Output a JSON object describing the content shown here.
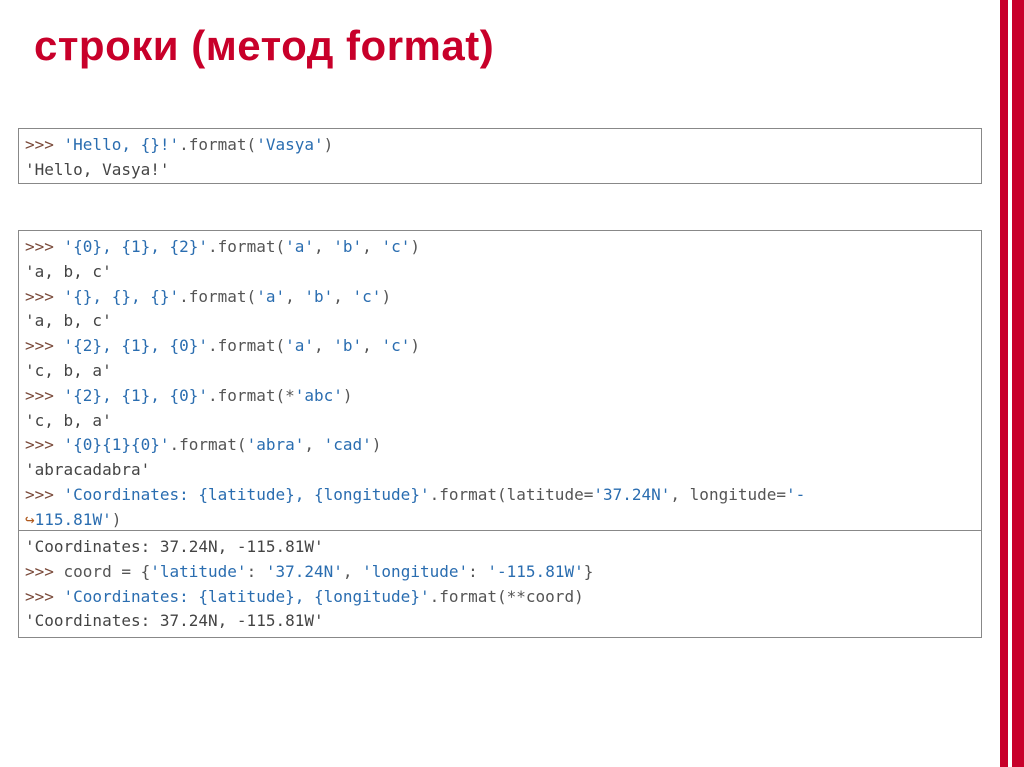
{
  "title": "строки (метод format)",
  "box1": {
    "l1_prompt": ">>> ",
    "l1_str": "'Hello, {}!'",
    "l1_call": ".format(",
    "l1_arg": "'Vasya'",
    "l1_close": ")",
    "l2": "'Hello, Vasya!'"
  },
  "box2": {
    "p": ">>> ",
    "l1_str": "'{0}, {1}, {2}'",
    "l1_call": ".format(",
    "l1_a1": "'a'",
    "l1_c": ", ",
    "l1_a2": "'b'",
    "l1_c2": ", ",
    "l1_a3": "'c'",
    "l1_close": ")",
    "r1": "'a, b, c'",
    "l2_str": "'{}, {}, {}'",
    "r2": "'a, b, c'",
    "l3_str": "'{2}, {1}, {0}'",
    "r3": "'c, b, a'",
    "l4_str": "'{2}, {1}, {0}'",
    "l4_call": ".format(*",
    "l4_arg": "'abc'",
    "l4_close": ")",
    "r4": "'c, b, a'",
    "l5_str": "'{0}{1}{0}'",
    "l5_a1": "'abra'",
    "l5_a2": "'cad'",
    "r5": "'abracadabra'",
    "l6_str": "'Coordinates: {latitude}, {longitude}'",
    "l6_call": ".format(latitude=",
    "l6_a1": "'37.24N'",
    "l6_mid": ", longitude=",
    "l6_a2": "'-",
    "l6_cont": "↪",
    "l6_a2b": "115.81W'",
    "l6_close": ")"
  },
  "box3": {
    "r0": "'Coordinates: 37.24N, -115.81W'",
    "p": ">>> ",
    "l1_lhs": "coord = {",
    "l1_k1": "'latitude'",
    "l1_sep1": ": ",
    "l1_v1": "'37.24N'",
    "l1_comma": ", ",
    "l1_k2": "'longitude'",
    "l1_sep2": ": ",
    "l1_v2": "'-115.81W'",
    "l1_end": "}",
    "l2_str": "'Coordinates: {latitude}, {longitude}'",
    "l2_call": ".format(**coord)",
    "r1": "'Coordinates: 37.24N, -115.81W'"
  }
}
